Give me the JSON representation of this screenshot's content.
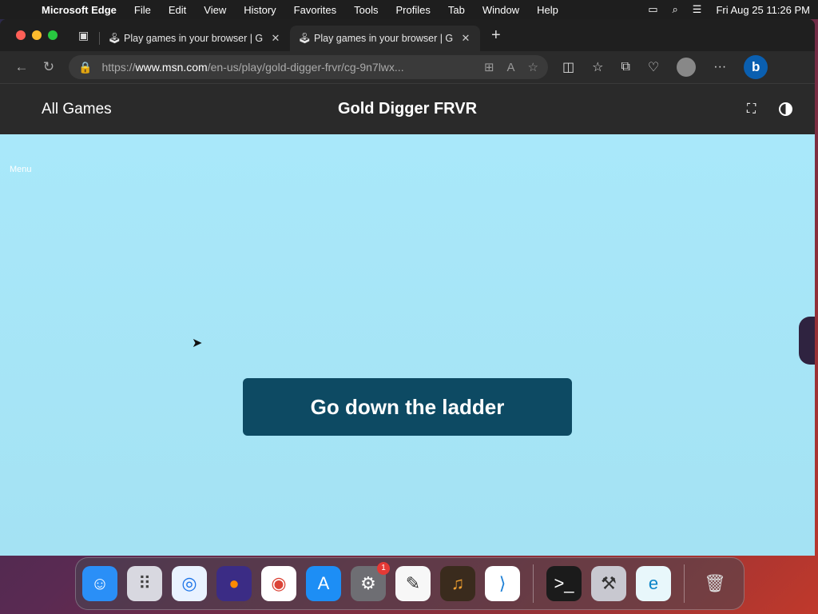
{
  "menubar": {
    "app_name": "Microsoft Edge",
    "items": [
      "File",
      "Edit",
      "View",
      "History",
      "Favorites",
      "Tools",
      "Profiles",
      "Tab",
      "Window",
      "Help"
    ],
    "clock": "Fri Aug 25  11:26 PM"
  },
  "tabs": [
    {
      "title": "Play games in your browser | G"
    },
    {
      "title": "Play games in your browser | G"
    }
  ],
  "address_bar": {
    "prefix": "https://",
    "domain": "www.msn.com",
    "path": "/en-us/play/gold-digger-frvr/cg-9n7lwx..."
  },
  "site_header": {
    "all_games": "All Games",
    "game_title": "Gold Digger FRVR"
  },
  "game": {
    "menu_label": "Menu",
    "cta_label": "Go down the ladder"
  },
  "dock": {
    "apps": [
      "Finder",
      "Launchpad",
      "Safari",
      "Firefox",
      "Chrome",
      "App Store",
      "System Settings",
      "TextEdit",
      "GarageBand",
      "VS Code",
      "Terminal",
      "Automator",
      "Edge",
      "Trash"
    ],
    "settings_badge": "1"
  }
}
